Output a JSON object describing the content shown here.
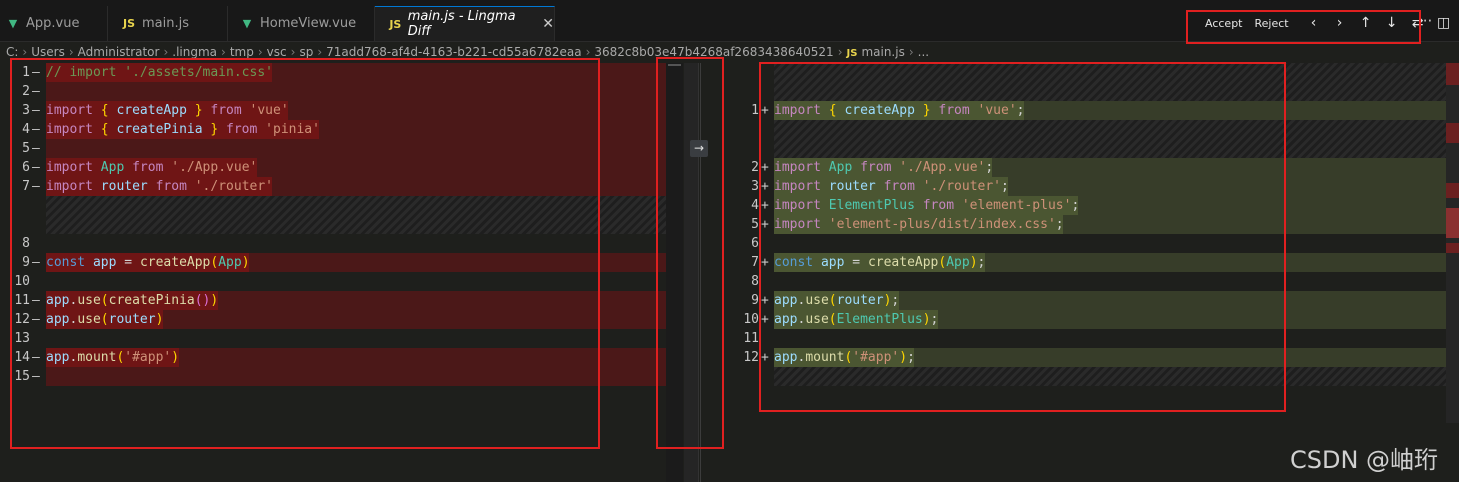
{
  "tabs": [
    {
      "label": "App.vue",
      "icon": "vue-icon",
      "active": false
    },
    {
      "label": "main.js",
      "icon": "js-icon",
      "active": false
    },
    {
      "label": "HomeView.vue",
      "icon": "vue-icon",
      "active": false
    },
    {
      "label": "main.js - Lingma Diff",
      "icon": "js-icon",
      "active": true
    }
  ],
  "close_glyph": "✕",
  "actions": {
    "accept": "Accept",
    "reject": "Reject",
    "prev": "‹",
    "next": "›",
    "up": "↑",
    "down": "↓",
    "swap": "⇄",
    "split": "◫",
    "more": "···"
  },
  "breadcrumb": {
    "parts": [
      "C:",
      "Users",
      "Administrator",
      ".lingma",
      "tmp",
      "vsc",
      "sp",
      "71add768-af4d-4163-b221-cd55a6782eaa",
      "3682c8b03e47b4268af2683438640521"
    ],
    "js_badge": "JS",
    "file": "main.js",
    "tail": "..."
  },
  "left": {
    "lines": [
      {
        "n": "1",
        "m": "—",
        "text": "// import './assets/main.css'"
      },
      {
        "n": "2",
        "m": "—",
        "text": ""
      },
      {
        "n": "3",
        "m": "—",
        "text": "import { createApp } from 'vue'"
      },
      {
        "n": "4",
        "m": "—",
        "text": "import { createPinia } from 'pinia'"
      },
      {
        "n": "5",
        "m": "—",
        "text": ""
      },
      {
        "n": "6",
        "m": "—",
        "text": "import App from './App.vue'"
      },
      {
        "n": "7",
        "m": "—",
        "text": "import router from './router'"
      },
      {
        "n": "8",
        "m": "",
        "text": ""
      },
      {
        "n": "9",
        "m": "—",
        "text": "const app = createApp(App)"
      },
      {
        "n": "10",
        "m": "",
        "text": ""
      },
      {
        "n": "11",
        "m": "—",
        "text": "app.use(createPinia())"
      },
      {
        "n": "12",
        "m": "—",
        "text": "app.use(router)"
      },
      {
        "n": "13",
        "m": "",
        "text": ""
      },
      {
        "n": "14",
        "m": "—",
        "text": "app.mount('#app')"
      },
      {
        "n": "15",
        "m": "—",
        "text": ""
      }
    ]
  },
  "right": {
    "lines": [
      {
        "n": "1",
        "m": "+",
        "text": "import { createApp } from 'vue';"
      },
      {
        "n": "2",
        "m": "+",
        "text": "import App from './App.vue';"
      },
      {
        "n": "3",
        "m": "+",
        "text": "import router from './router';"
      },
      {
        "n": "4",
        "m": "+",
        "text": "import ElementPlus from 'element-plus';"
      },
      {
        "n": "5",
        "m": "+",
        "text": "import 'element-plus/dist/index.css';"
      },
      {
        "n": "6",
        "m": "",
        "text": ""
      },
      {
        "n": "7",
        "m": "+",
        "text": "const app = createApp(App);"
      },
      {
        "n": "8",
        "m": "",
        "text": ""
      },
      {
        "n": "9",
        "m": "+",
        "text": "app.use(router);"
      },
      {
        "n": "10",
        "m": "+",
        "text": "app.use(ElementPlus);"
      },
      {
        "n": "11",
        "m": "",
        "text": ""
      },
      {
        "n": "12",
        "m": "+",
        "text": "app.mount('#app');"
      }
    ]
  },
  "diff_arrow": "→",
  "watermark": "CSDN @岫珩"
}
